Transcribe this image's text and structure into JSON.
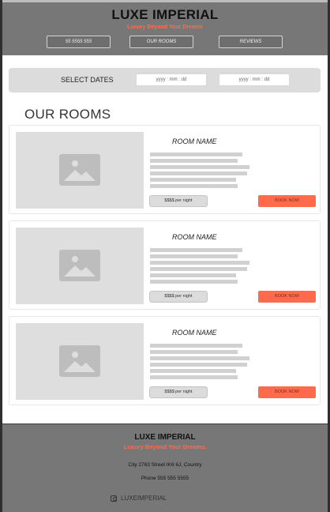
{
  "header": {
    "brand": "LUXE IMPERIAL",
    "tagline": "Luxury Beyond Your Dreams",
    "nav": [
      {
        "label": "55 5555 555"
      },
      {
        "label": "OUR ROOMS"
      },
      {
        "label": "REVIEWS"
      }
    ]
  },
  "dates": {
    "label": "SELECT DATES",
    "checkin_placeholder": "yyyy : mm : dd",
    "checkout_placeholder": "yyyy : mm : dd"
  },
  "rooms_section": {
    "title": "OUR ROOMS",
    "rooms": [
      {
        "name": "ROOM NAME",
        "price": "$$$$ per night",
        "book": "BOOK NOW",
        "image_icon": "image-placeholder-icon"
      },
      {
        "name": "ROOM NAME",
        "price": "$$$$ per night",
        "book": "BOOK NOW",
        "image_icon": "image-placeholder-icon"
      },
      {
        "name": "ROOM NAME",
        "price": "$$$$ per night",
        "book": "BOOK NOW",
        "image_icon": "image-placeholder-icon"
      }
    ]
  },
  "footer": {
    "brand": "LUXE IMPERIAL",
    "tagline": "Luxury Beyond Your Dreams.",
    "address": "City 2763 Street IK6 6J, Country",
    "phone": "Phone 555 555 5555",
    "social_icon": "instagram-icon",
    "social_handle": "LUXEIMPERIAL"
  },
  "colors": {
    "accent": "#ff6b4a",
    "header_bg": "#777777",
    "placeholder": "#dedede"
  }
}
